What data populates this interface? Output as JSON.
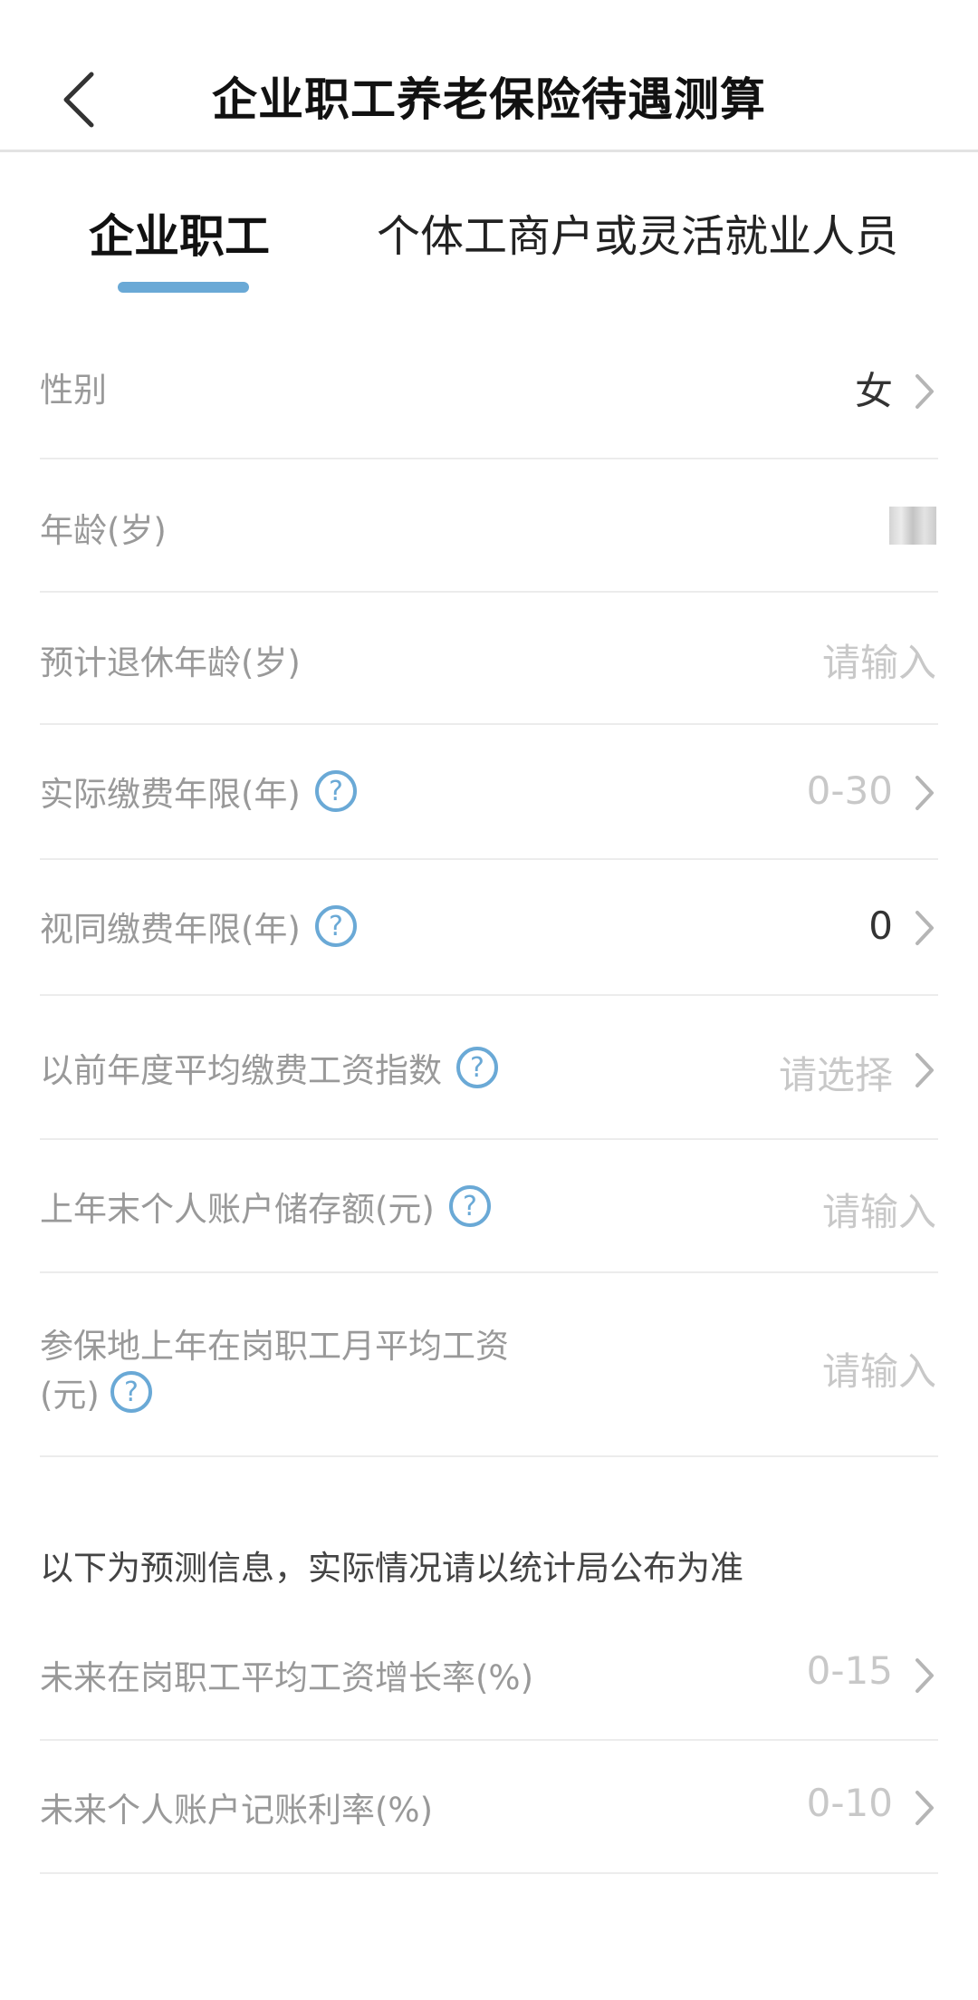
{
  "header": {
    "title": "企业职工养老保险待遇测算",
    "back_icon": "chevron-left-icon"
  },
  "tabs": [
    {
      "label": "企业职工",
      "active": true
    },
    {
      "label": "个体工商户或灵活就业人员",
      "active": false
    }
  ],
  "form": {
    "gender": {
      "label": "性别",
      "value": "女"
    },
    "age": {
      "label": "年龄(岁)"
    },
    "retire_age": {
      "label": "预计退休年龄(岁)",
      "placeholder": "请输入"
    },
    "actual_years": {
      "label": "实际缴费年限(年)",
      "placeholder": "0-30"
    },
    "deemed_years": {
      "label": "视同缴费年限(年)",
      "value": "0"
    },
    "wage_index": {
      "label": "以前年度平均缴费工资指数",
      "placeholder": "请选择"
    },
    "account_balance": {
      "label": "上年末个人账户储存额(元)",
      "placeholder": "请输入"
    },
    "avg_wage": {
      "label_line1": "参保地上年在岗职工月平均工资",
      "label_line2": "(元)",
      "placeholder": "请输入"
    }
  },
  "notice": "以下为预测信息，实际情况请以统计局公布为准",
  "forecast": {
    "wage_growth": {
      "label": "未来在岗职工平均工资增长率(%)",
      "placeholder": "0-15"
    },
    "interest_rate": {
      "label": "未来个人账户记账利率(%)",
      "placeholder": "0-10"
    }
  },
  "colors": {
    "accent": "#6aa9d6",
    "help_icon": "#6aa9d6"
  }
}
